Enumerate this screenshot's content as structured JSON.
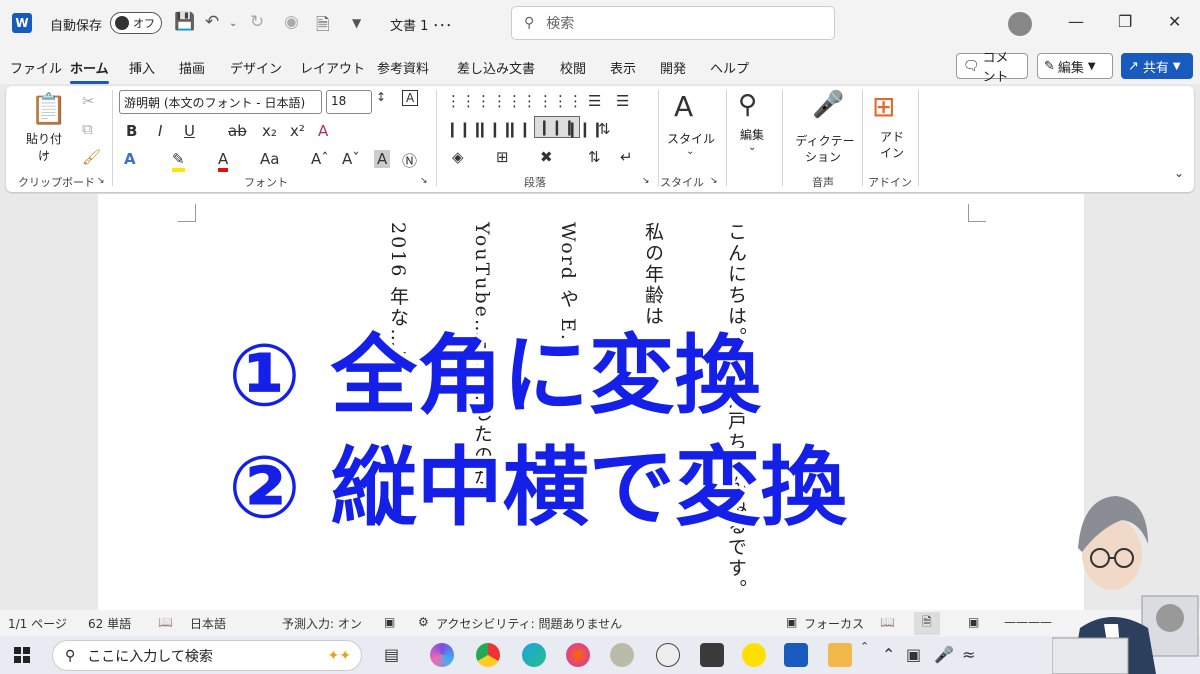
{
  "titlebar": {
    "autosave_label": "自動保存",
    "autosave_state": "オフ",
    "doc_title": "文書 1 ･･･",
    "search_placeholder": "検索"
  },
  "menu": {
    "tabs": [
      "ファイル",
      "ホーム",
      "挿入",
      "描画",
      "デザイン",
      "レイアウト",
      "参考資料",
      "差し込み文書",
      "校閲",
      "表示",
      "開発",
      "ヘルプ"
    ],
    "active_tab": "ホーム",
    "comment_button": "コメント",
    "edit_button": "編集",
    "share_button": "共有"
  },
  "ribbon": {
    "clipboard": {
      "paste_label": "貼り付け",
      "group_label": "クリップボード"
    },
    "font": {
      "font_name": "游明朝 (本文のフォント - 日本語)",
      "font_size": "18",
      "group_label": "フォント",
      "case_label": "Aa"
    },
    "paragraph": {
      "group_label": "段落"
    },
    "styles": {
      "label": "スタイル",
      "group_label": "スタイル"
    },
    "editing": {
      "label": "編集"
    },
    "voice": {
      "label_line1": "ディクテー",
      "label_line2": "ション",
      "group_label": "音声"
    },
    "addins": {
      "label_line1": "アド",
      "label_line2": "イン",
      "group_label": "アドイン"
    }
  },
  "document": {
    "columns": [
      "こんにちは。〇〇江戸ちゃんねるです。",
      "私の年齢は",
      "Word や E...",
      "YouTube…ルを…したのが、",
      "2016 年な…!"
    ]
  },
  "overlay": {
    "line1": "① 全角に変換",
    "line2": "② 縦中横で変換",
    "color": "#1420e8"
  },
  "statusbar": {
    "page": "1/1 ページ",
    "words": "62 単語",
    "language": "日本語",
    "predictive": "予測入力: オン",
    "accessibility": "アクセシビリティ: 問題ありません",
    "focus": "フォーカス"
  },
  "taskbar": {
    "search_placeholder": "ここに入力して検索"
  }
}
